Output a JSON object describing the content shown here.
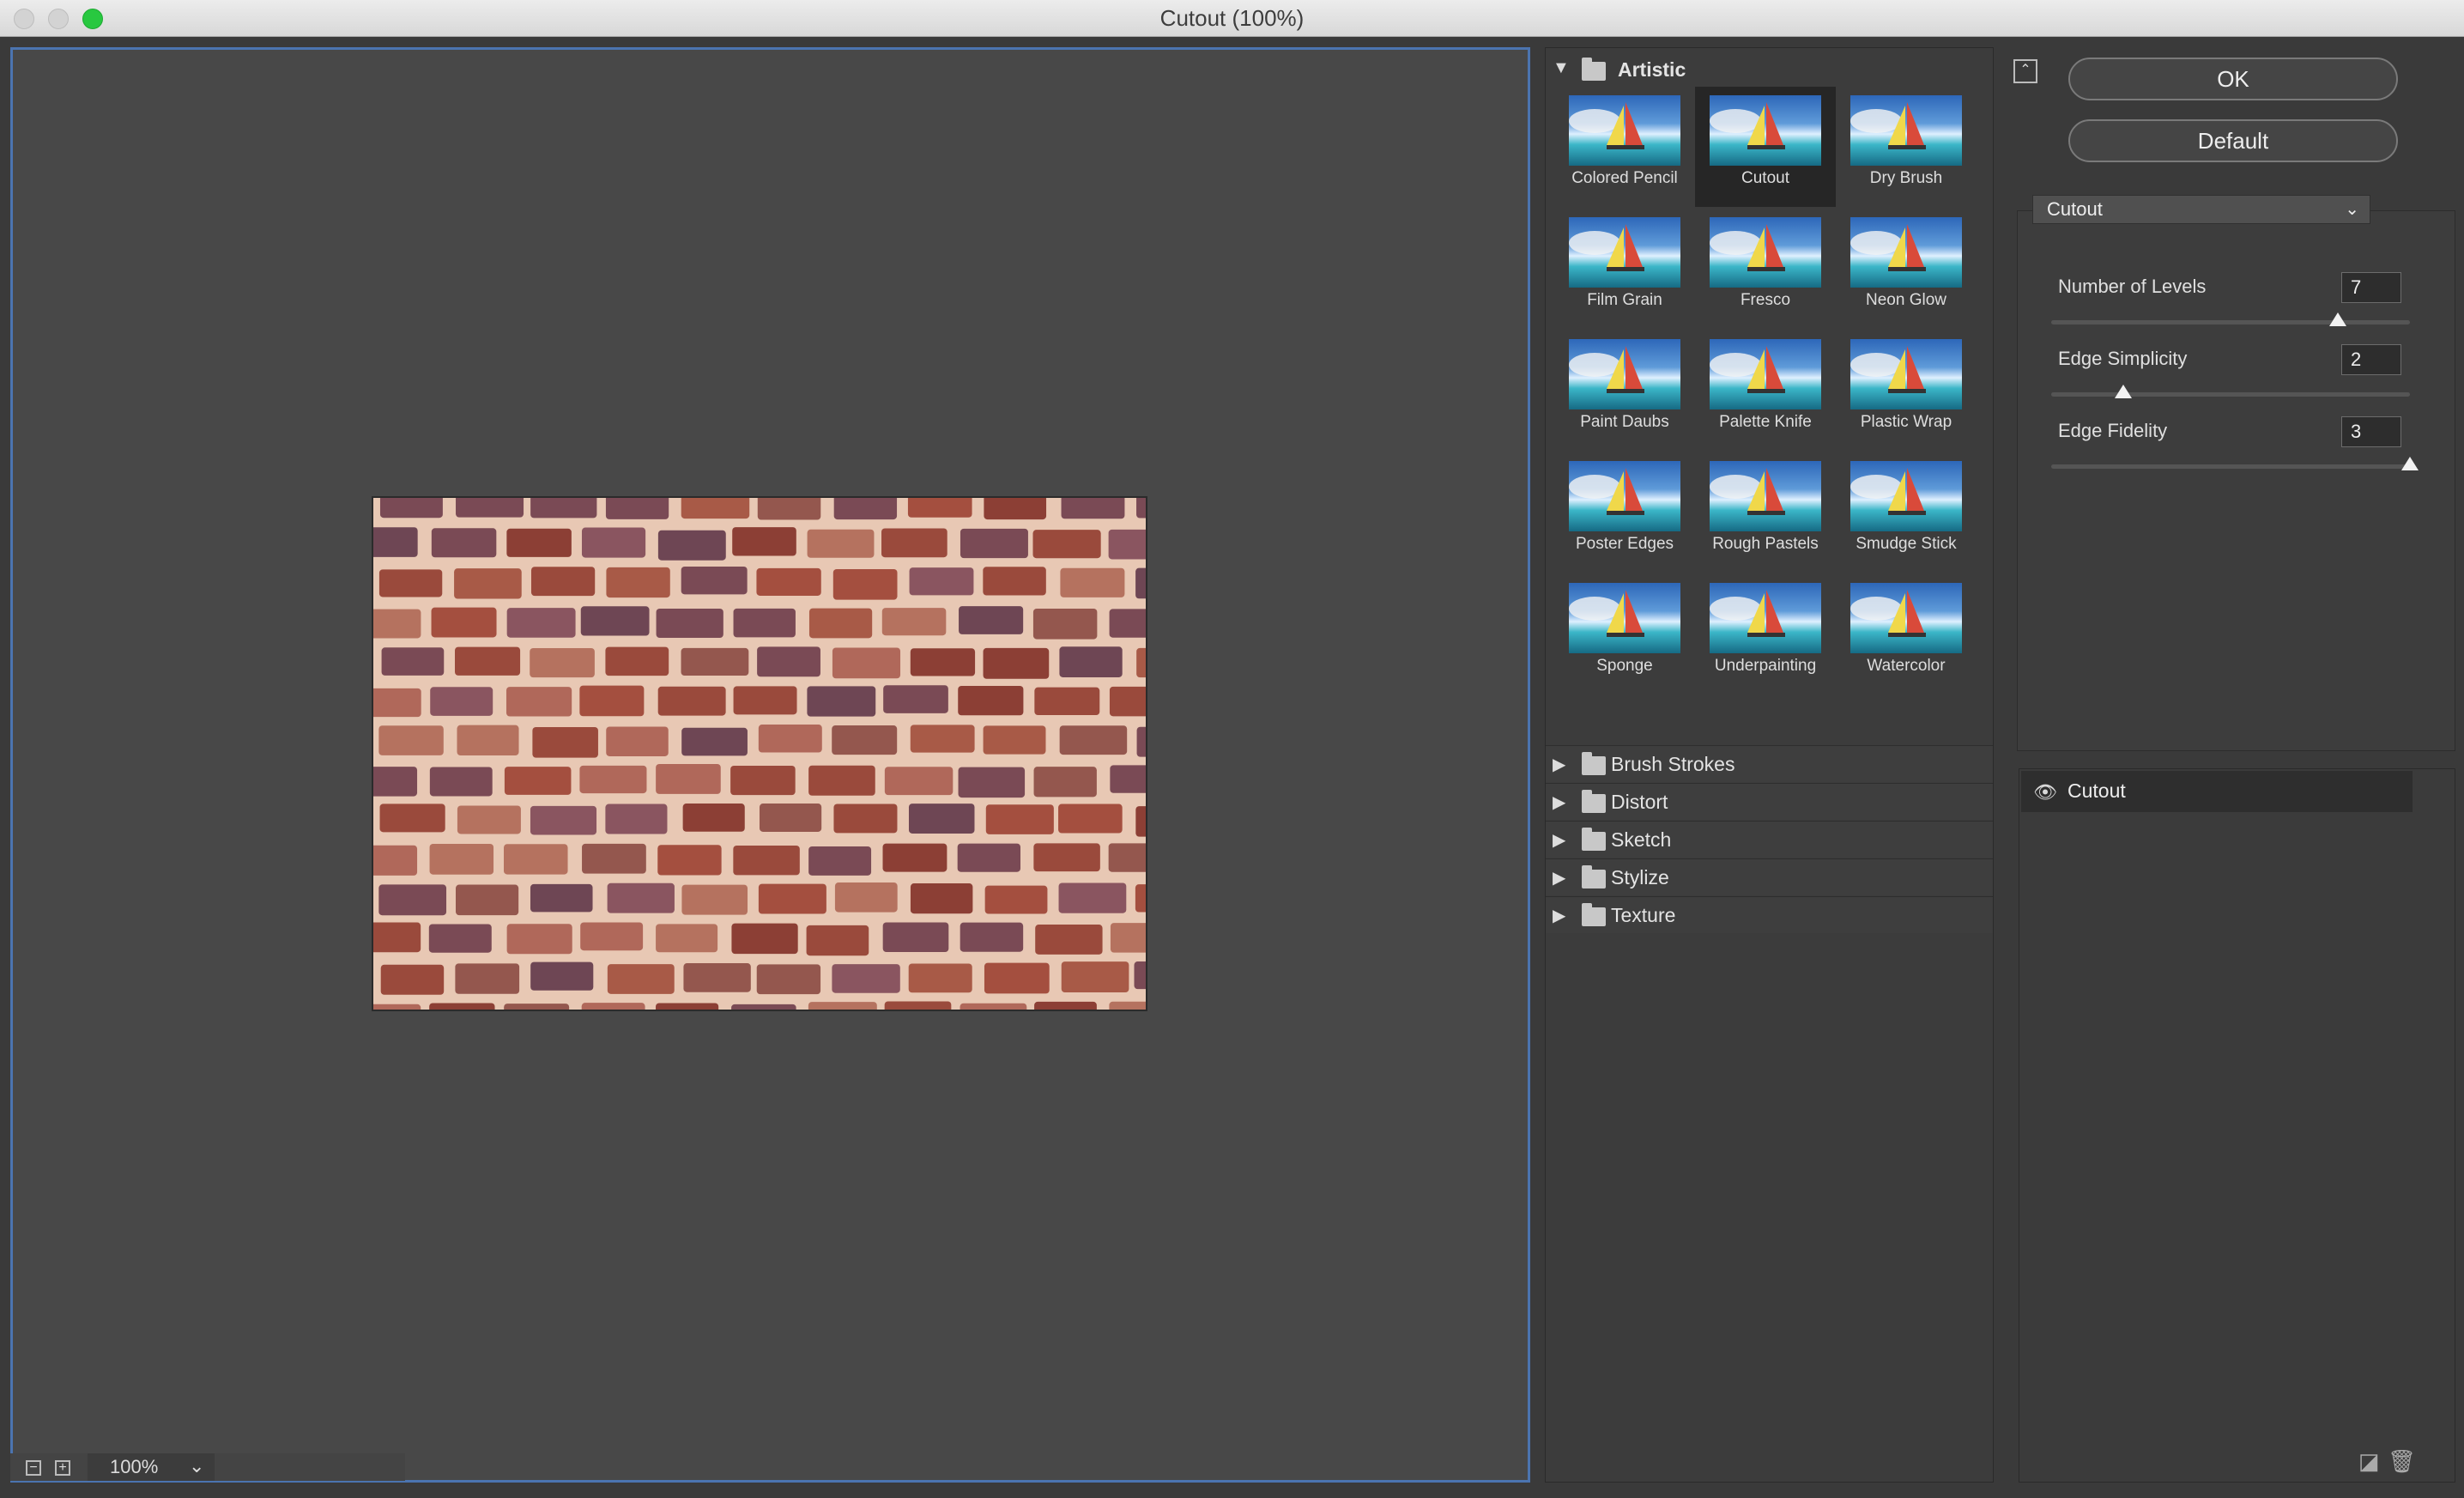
{
  "window": {
    "title": "Cutout (100%)"
  },
  "preview": {
    "zoom": "100%",
    "minus": "−",
    "plus": "+",
    "chevron": "⌄"
  },
  "browser": {
    "open_category": "Artistic",
    "filters": [
      {
        "label": "Colored Pencil"
      },
      {
        "label": "Cutout"
      },
      {
        "label": "Dry Brush"
      },
      {
        "label": "Film Grain"
      },
      {
        "label": "Fresco"
      },
      {
        "label": "Neon Glow"
      },
      {
        "label": "Paint Daubs"
      },
      {
        "label": "Palette Knife"
      },
      {
        "label": "Plastic Wrap"
      },
      {
        "label": "Poster Edges"
      },
      {
        "label": "Rough Pastels"
      },
      {
        "label": "Smudge Stick"
      },
      {
        "label": "Sponge"
      },
      {
        "label": "Underpainting"
      },
      {
        "label": "Watercolor"
      }
    ],
    "selected_filter": "Cutout",
    "collapsed_categories": [
      {
        "label": "Brush Strokes"
      },
      {
        "label": "Distort"
      },
      {
        "label": "Sketch"
      },
      {
        "label": "Stylize"
      },
      {
        "label": "Texture"
      }
    ]
  },
  "buttons": {
    "ok": "OK",
    "default": "Default"
  },
  "settings": {
    "filter_select": "Cutout",
    "params": [
      {
        "label": "Number of Levels",
        "value": "7",
        "fraction": 0.8
      },
      {
        "label": "Edge Simplicity",
        "value": "2",
        "fraction": 0.2
      },
      {
        "label": "Edge Fidelity",
        "value": "3",
        "fraction": 1.0
      }
    ]
  },
  "layers": {
    "items": [
      {
        "name": "Cutout",
        "visible": true
      }
    ]
  },
  "icons": {
    "collapse": "collapse-panel-icon",
    "eye": "eye-icon",
    "new_layer": "new-effect-layer-icon",
    "delete": "trash-icon"
  },
  "colors": {
    "accent": "#4b74b0",
    "zoom_light": "#28c840"
  }
}
